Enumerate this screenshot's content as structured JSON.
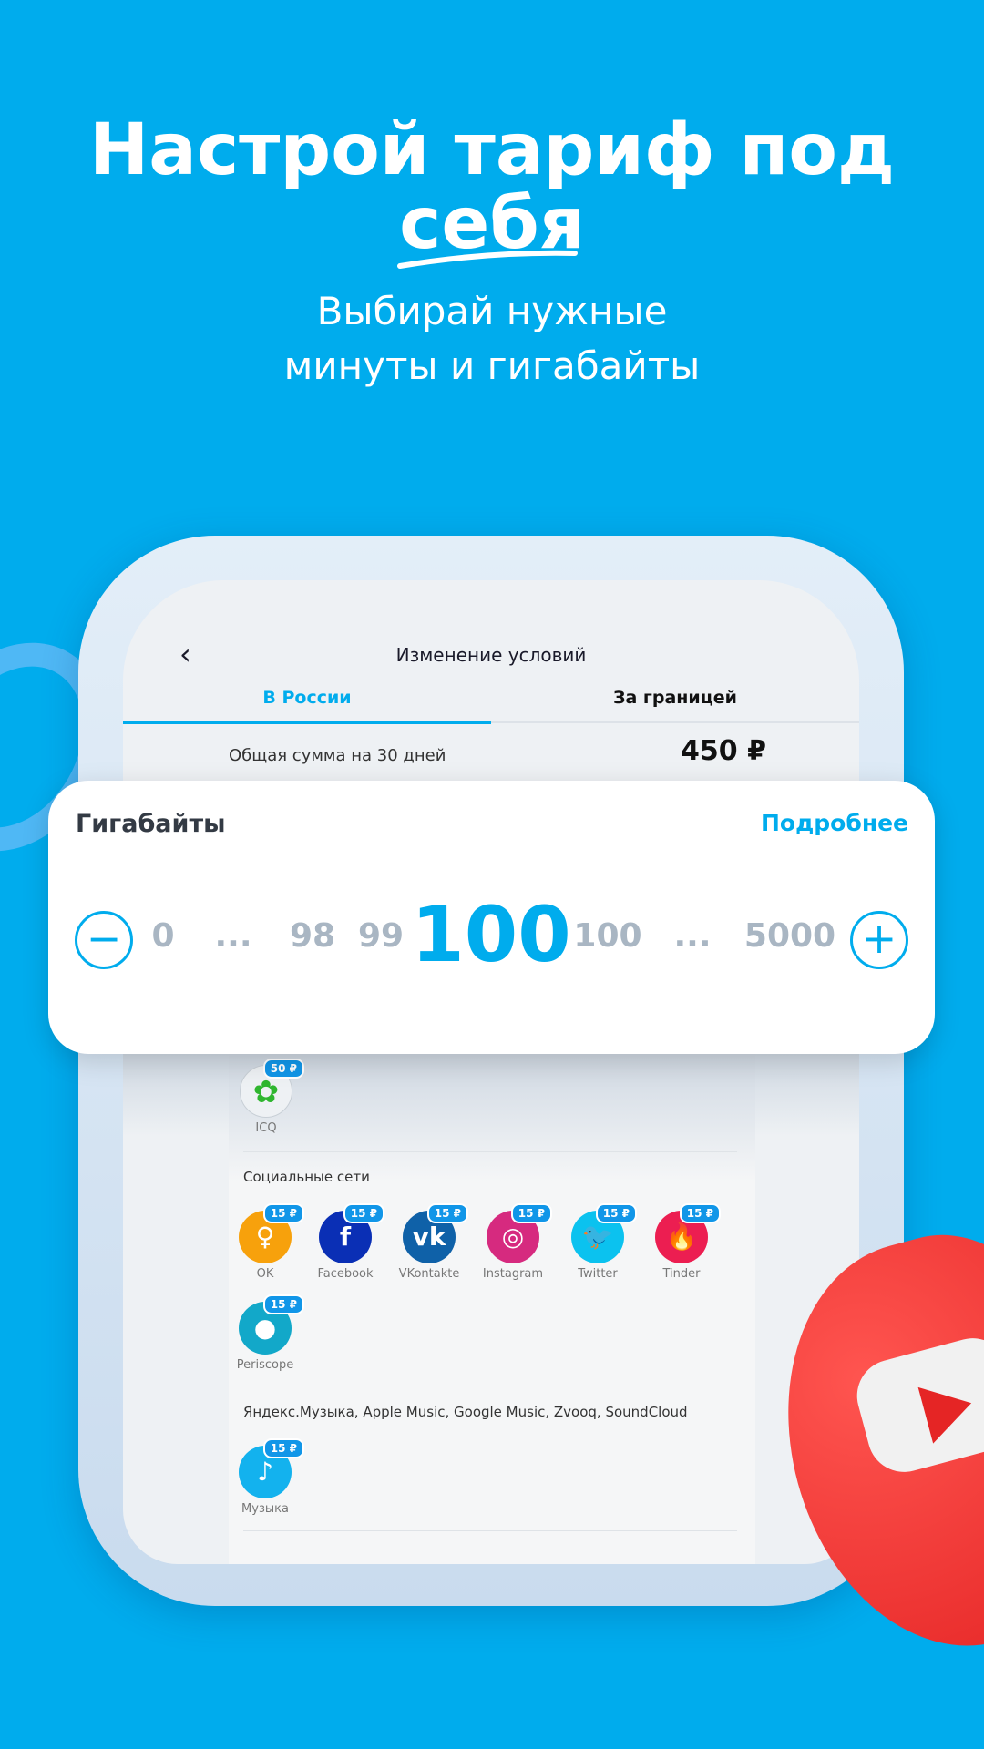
{
  "headline": {
    "line1": "Настрой тариф под",
    "line2": "себя",
    "subtitle_line1": "Выбирай нужные",
    "subtitle_line2": "минуты и гигабайты"
  },
  "screen": {
    "title": "Изменение условий",
    "tabs": [
      {
        "label": "В России",
        "active": true
      },
      {
        "label": "За границей",
        "active": false
      }
    ],
    "total_label": "Общая сумма на 30 дней",
    "total_value": "450 ₽"
  },
  "gb_card": {
    "title": "Гигабайты",
    "more_link": "Подробнее",
    "values": [
      "0",
      "...",
      "98",
      "99",
      "100",
      "100",
      "...",
      "5000"
    ],
    "selected": "100"
  },
  "messengers": [
    {
      "name": "ICQ",
      "price": "50 ₽",
      "color": "#eef1f4"
    }
  ],
  "social": {
    "title": "Социальные сети",
    "apps": [
      {
        "name": "OK",
        "price": "15 ₽",
        "color": "#f7a10c",
        "glyph": "ok"
      },
      {
        "name": "Facebook",
        "price": "15 ₽",
        "color": "#0a2fb5",
        "glyph": "f"
      },
      {
        "name": "VKontakte",
        "price": "15 ₽",
        "color": "#0f61a8",
        "glyph": "vk"
      },
      {
        "name": "Instagram",
        "price": "15 ₽",
        "color": "#d62a7f",
        "glyph": "◎"
      },
      {
        "name": "Twitter",
        "price": "15 ₽",
        "color": "#0bc2ef",
        "glyph": "🐦"
      },
      {
        "name": "Tinder",
        "price": "15 ₽",
        "color": "#ec1e51",
        "glyph": "🔥"
      },
      {
        "name": "Periscope",
        "price": "15 ₽",
        "color": "#12a8c9",
        "glyph": "●"
      }
    ]
  },
  "music": {
    "title": "Яндекс.Музыка, Apple Music, Google Music, Zvooq, SoundCloud",
    "apps": [
      {
        "name": "Музыка",
        "price": "15 ₽",
        "color": "#13b2ee",
        "glyph": "♪"
      }
    ]
  }
}
